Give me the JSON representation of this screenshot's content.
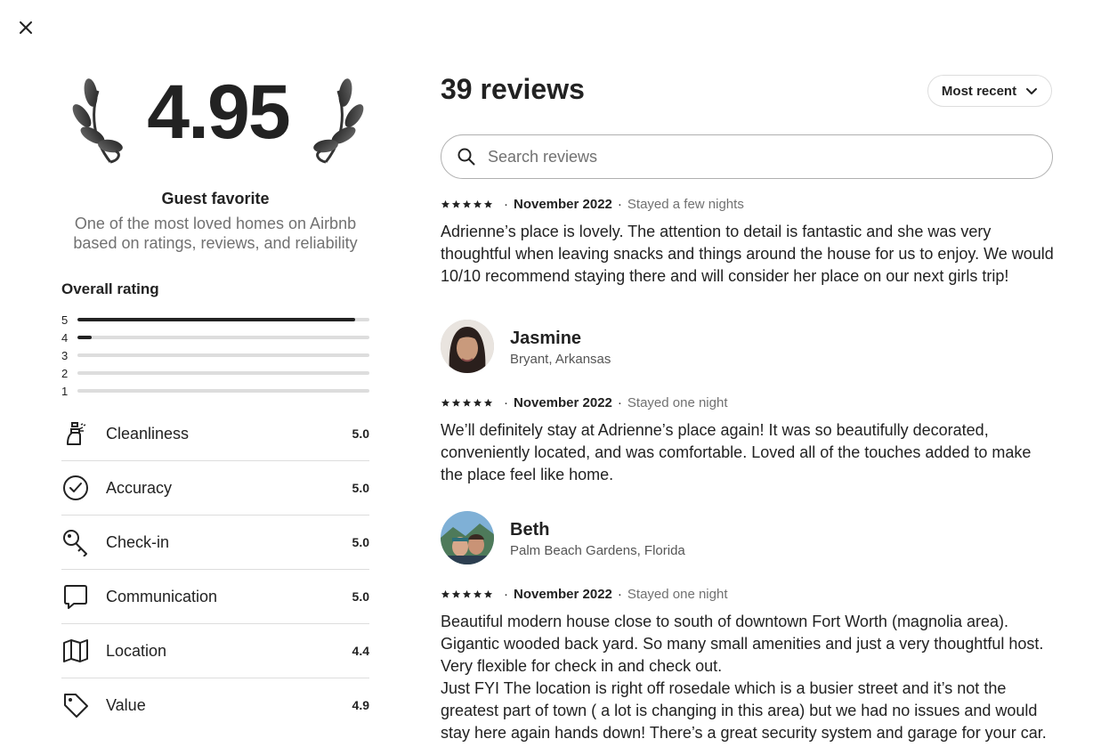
{
  "summary": {
    "rating": "4.95",
    "badge_title": "Guest favorite",
    "badge_description": "One of the most loved homes on Airbnb based on ratings, reviews, and reliability"
  },
  "overall": {
    "title": "Overall rating",
    "distribution": [
      {
        "stars": "5",
        "fraction": 0.95
      },
      {
        "stars": "4",
        "fraction": 0.05
      },
      {
        "stars": "3",
        "fraction": 0
      },
      {
        "stars": "2",
        "fraction": 0
      },
      {
        "stars": "1",
        "fraction": 0
      }
    ]
  },
  "categories": [
    {
      "label": "Cleanliness",
      "score": "5.0",
      "icon": "spray-bottle-icon"
    },
    {
      "label": "Accuracy",
      "score": "5.0",
      "icon": "check-circle-icon"
    },
    {
      "label": "Check-in",
      "score": "5.0",
      "icon": "key-icon"
    },
    {
      "label": "Communication",
      "score": "5.0",
      "icon": "chat-bubble-icon"
    },
    {
      "label": "Location",
      "score": "4.4",
      "icon": "map-icon"
    },
    {
      "label": "Value",
      "score": "4.9",
      "icon": "tag-icon"
    }
  ],
  "reviews_header": {
    "count_label": "39 reviews",
    "sort_label": "Most recent",
    "search_placeholder": "Search reviews"
  },
  "reviews": [
    {
      "name": "",
      "location": "",
      "rating": 5,
      "date": "November 2022",
      "stay": "Stayed a few nights",
      "text": "Adrienne’s place is lovely. The attention to detail is fantastic and she was very thoughtful when leaving snacks and things around the house for us to enjoy. We would 10/10 recommend staying there and will consider her place on our next girls trip!"
    },
    {
      "name": "Jasmine",
      "location": "Bryant, Arkansas",
      "rating": 5,
      "date": "November 2022",
      "stay": "Stayed one night",
      "text": "We’ll definitely stay at Adrienne’s place again! It was so beautifully decorated, conveniently located, and was comfortable. Loved all of the touches added to make the place feel like home."
    },
    {
      "name": "Beth",
      "location": "Palm Beach Gardens, Florida",
      "rating": 5,
      "date": "November 2022",
      "stay": "Stayed one night",
      "text": "Beautiful modern house close to south of downtown Fort Worth (magnolia area). Gigantic wooded back yard. So many small amenities and just a very thoughtful host. Very flexible for check in and check out.\nJust FYI The location is right off rosedale which is a busier street and it’s not the greatest part of town ( a lot is changing in this area) but we had no issues and would stay here again hands down! There’s a great security system and garage for your car."
    }
  ],
  "colors": {
    "text": "#222222",
    "muted": "#717171",
    "divider": "#dddddd",
    "bar_fill": "#222222",
    "bar_track": "#dddddd"
  }
}
